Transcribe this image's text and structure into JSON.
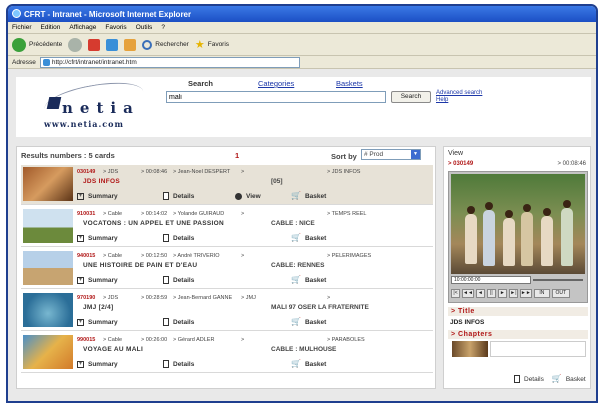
{
  "browser": {
    "title": "CFRT - Intranet - Microsoft Internet Explorer",
    "menu": [
      "Fichier",
      "Edition",
      "Affichage",
      "Favoris",
      "Outils",
      "?"
    ],
    "toolbar": {
      "back_label": "Précédente",
      "search_label": "Rechercher",
      "favorites_label": "Favoris"
    },
    "address_label": "Adresse",
    "address_value": "http://cfrt/intranet/intranet.htm"
  },
  "header": {
    "logo_word": "netia",
    "logo_url": "www.netia.com",
    "nav": {
      "search": "Search",
      "categories": "Categories",
      "baskets": "Baskets"
    },
    "search_value": "mali",
    "search_button": "Search",
    "advanced_search": "Advanced search",
    "help": "Help"
  },
  "results": {
    "count_label": "Results numbers : 5 cards",
    "page": "1",
    "sort_label": "Sort by",
    "sort_value": "# Prod",
    "actions": {
      "summary": "Summary",
      "details": "Details",
      "view": "View",
      "basket": "Basket"
    },
    "cards": [
      {
        "id": "030149",
        "source": "> JDS",
        "duration": "> 00:08:46",
        "author": "> Jean-Noel DESPERT",
        "col5": ">",
        "col6": "> JDS INFOS",
        "title": "JDS INFOS",
        "extra": "[05]",
        "has_view": true
      },
      {
        "id": "910031",
        "source": "> Cable",
        "duration": "> 00:14:02",
        "author": "> Yolande GUIRAUD",
        "col5": ">",
        "col6": "> TEMPS REEL",
        "title": "VOCATONS : UN APPEL ET UNE PASSION",
        "extra": "CABLE : NICE",
        "has_view": false
      },
      {
        "id": "940015",
        "source": "> Cable",
        "duration": "> 00:12:50",
        "author": "> André TRIVERIO",
        "col5": ">",
        "col6": "> PELERIMAGES",
        "title": "UNE HISTOIRE DE PAIN ET D'EAU",
        "extra": "CABLE: RENNES",
        "has_view": false
      },
      {
        "id": "970190",
        "source": "> JDS",
        "duration": "> 00:28:59",
        "author": "> Jean-Bernard GANNE",
        "col5": "> JMJ",
        "col6": ">",
        "title": "JMJ [2/4]",
        "extra": "MALI 97 OSER LA FRATERNITE",
        "has_view": false
      },
      {
        "id": "990015",
        "source": "> Cable",
        "duration": "> 00:26:00",
        "author": "> Gérard ADLER",
        "col5": ">",
        "col6": "> PARABOLES",
        "title": "VOYAGE AU MALI",
        "extra": "CABLE : MULHOUSE",
        "has_view": false
      }
    ]
  },
  "view": {
    "label": "View",
    "id": "> 030149",
    "duration": "> 00:08:46",
    "timecode": "10:00:00:00",
    "controls": [
      "|<",
      "◄◄",
      "◄",
      "||",
      "►",
      "►|",
      "►►",
      "IN",
      "OUT"
    ],
    "title_section": "> Title",
    "title_value": "JDS INFOS",
    "chapters_section": "> Chapters",
    "details": "Details",
    "basket": "Basket"
  }
}
